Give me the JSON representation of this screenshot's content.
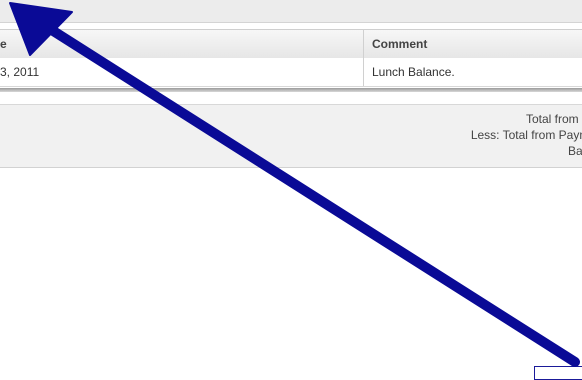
{
  "table": {
    "headers": [
      "e",
      "Comment"
    ],
    "rows": [
      {
        "date": "3, 2011",
        "comment": "Lunch Balance."
      }
    ]
  },
  "totals": {
    "lines": [
      "Total from Fo",
      "Less: Total from Payme",
      "Balar"
    ]
  },
  "annotation": {
    "arrow_color": "#0a0a96",
    "icon": "double-headed-arrow"
  }
}
